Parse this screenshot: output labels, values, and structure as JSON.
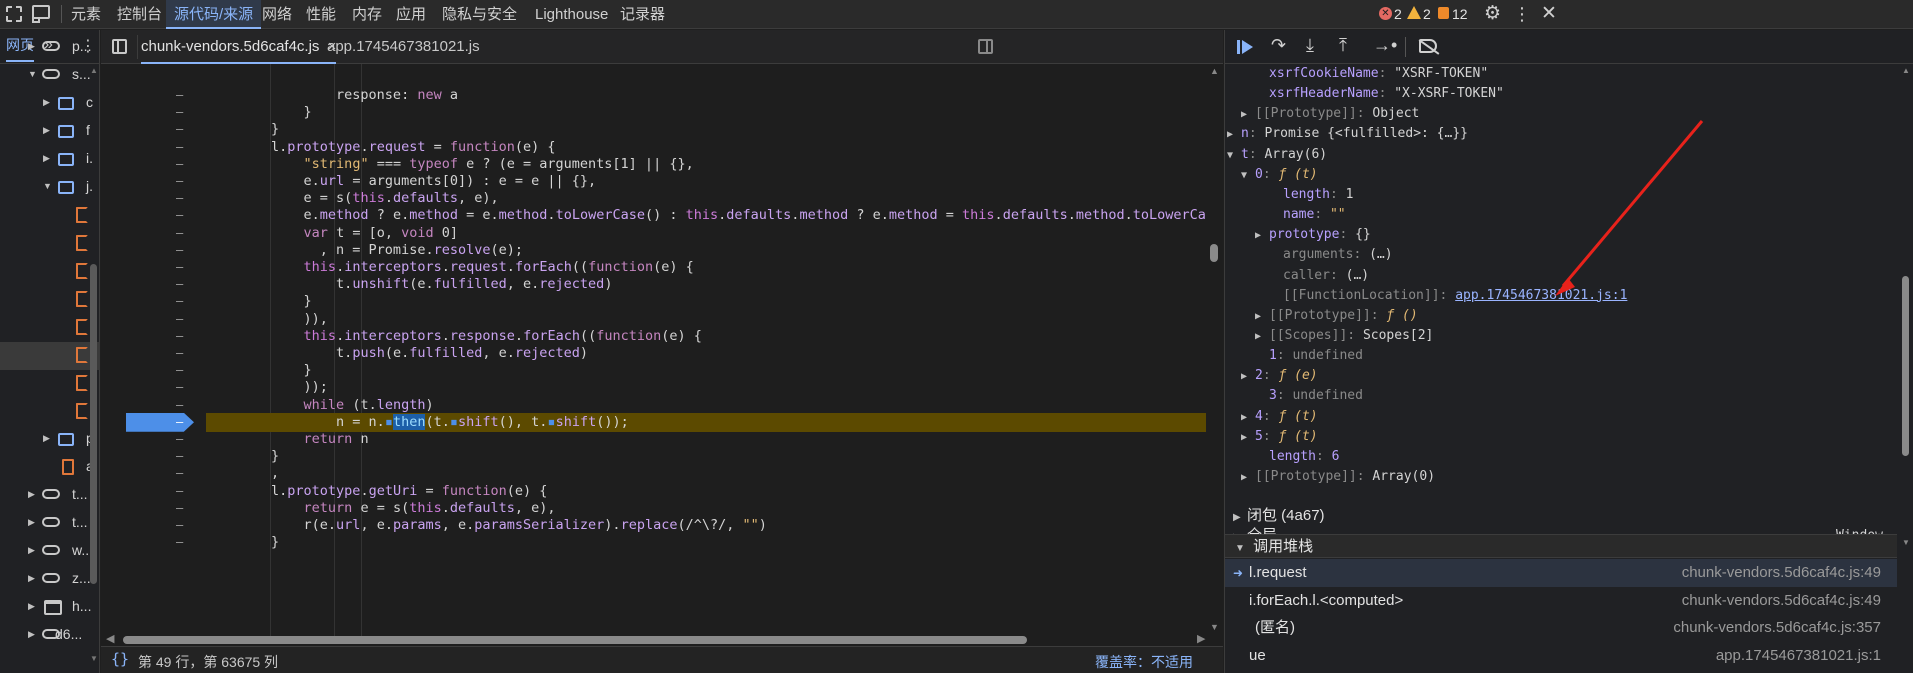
{
  "toolbar": {
    "tabs": [
      "元素",
      "控制台",
      "源代码/来源",
      "网络",
      "性能",
      "内存",
      "应用",
      "隐私与安全",
      "Lighthouse",
      "记录器"
    ],
    "errors": "2",
    "warnings": "2",
    "issues": "12"
  },
  "navigator": {
    "tab_label": "网页",
    "rows": [
      {
        "label": "p..."
      },
      {
        "label": "s..."
      },
      {
        "label": "c"
      },
      {
        "label": "f"
      },
      {
        "label": "i."
      },
      {
        "label": "j."
      },
      {
        "label": ""
      },
      {
        "label": ""
      },
      {
        "label": ""
      },
      {
        "label": ""
      },
      {
        "label": ""
      },
      {
        "label": ""
      },
      {
        "label": ""
      },
      {
        "label": ""
      },
      {
        "label": "p"
      },
      {
        "label": "a"
      },
      {
        "label": "t..."
      },
      {
        "label": "t..."
      },
      {
        "label": "w..."
      },
      {
        "label": "z..."
      },
      {
        "label": "h..."
      },
      {
        "label": "d6..."
      }
    ]
  },
  "editor": {
    "tabs": [
      {
        "label": "chunk-vendors.5d6caf4c.js",
        "close": "×"
      },
      {
        "label": "app.1745467381021.js"
      }
    ],
    "gutter_marker": "–",
    "code_lines": [
      "                response: new a",
      "            }",
      "        }",
      "        l.prototype.request = function(e) {",
      "            \"string\" === typeof e ? (e = arguments[1] || {},",
      "            e.url = arguments[0]) : e = e || {},",
      "            e = s(this.defaults, e),",
      "            e.method ? e.method = e.method.toLowerCase() : this.defaults.method ? e.method = this.defaults.method.toLowerCas",
      "            var t = [o, void 0]",
      "              , n = Promise.resolve(e);",
      "            this.interceptors.request.forEach((function(e) {",
      "                t.unshift(e.fulfilled, e.rejected)",
      "            }",
      "            )),",
      "            this.interceptors.response.forEach((function(e) {",
      "                t.push(e.fulfilled, e.rejected)",
      "            }",
      "            ));",
      "            while (t.length)",
      "                n = n.Dthen(t.Dshift(), t.Dshift());",
      "            return n",
      "        }",
      "        ,",
      "        l.prototype.getUri = function(e) {",
      "            return e = s(this.defaults, e),",
      "            r(e.url, e.params, e.paramsSerializer).replace(/^\\?/, \"\")",
      "        }"
    ],
    "status_position": "第 49 行，第 63675 列",
    "status_coverage": "覆盖率：不适用"
  },
  "scope": {
    "rows": [
      {
        "key": "xsrfCookieName",
        "value": "\"XSRF-TOKEN\""
      },
      {
        "key": "xsrfHeaderName",
        "value": "\"X-XSRF-TOKEN\""
      },
      {
        "key": "[[Prototype]]",
        "value": "Object"
      },
      {
        "key": "n",
        "value": "Promise {<fulfilled>: {…}}"
      },
      {
        "key": "t",
        "value": "Array(6)"
      },
      {
        "key": "0",
        "value": "ƒ (t)"
      },
      {
        "key": "length",
        "value": "1"
      },
      {
        "key": "name",
        "value": "\"\""
      },
      {
        "key": "prototype",
        "value": "{}"
      },
      {
        "key": "arguments",
        "value": "(…)"
      },
      {
        "key": "caller",
        "value": "(…)"
      },
      {
        "key": "[[FunctionLocation]]",
        "value": "app.1745467381021.js:1"
      },
      {
        "key": "[[Prototype]]",
        "value": "ƒ ()"
      },
      {
        "key": "[[Scopes]]",
        "value": "Scopes[2]"
      },
      {
        "key": "1",
        "value": "undefined"
      },
      {
        "key": "2",
        "value": "ƒ (e)"
      },
      {
        "key": "3",
        "value": "undefined"
      },
      {
        "key": "4",
        "value": "ƒ (t)"
      },
      {
        "key": "5",
        "value": "ƒ (t)"
      },
      {
        "key": "length",
        "value": "6"
      },
      {
        "key": "[[Prototype]]",
        "value": "Array(0)"
      }
    ],
    "closure": "闭包 (4a67)",
    "global": "全局",
    "global_value": "Window"
  },
  "call_stack": {
    "title": "调用堆栈",
    "frames": [
      {
        "fn": "l.request",
        "loc": "chunk-vendors.5d6caf4c.js:49"
      },
      {
        "fn": "i.forEach.l.<computed>",
        "loc": "chunk-vendors.5d6caf4c.js:49"
      },
      {
        "fn": "(匿名)",
        "loc": "chunk-vendors.5d6caf4c.js:357"
      },
      {
        "fn": "ue",
        "loc": "app.1745467381021.js:1"
      }
    ]
  },
  "colors": {
    "accent": "#8ab4f8",
    "annotation_arrow": "#e8221b",
    "paused_line": "#5c4a00"
  }
}
